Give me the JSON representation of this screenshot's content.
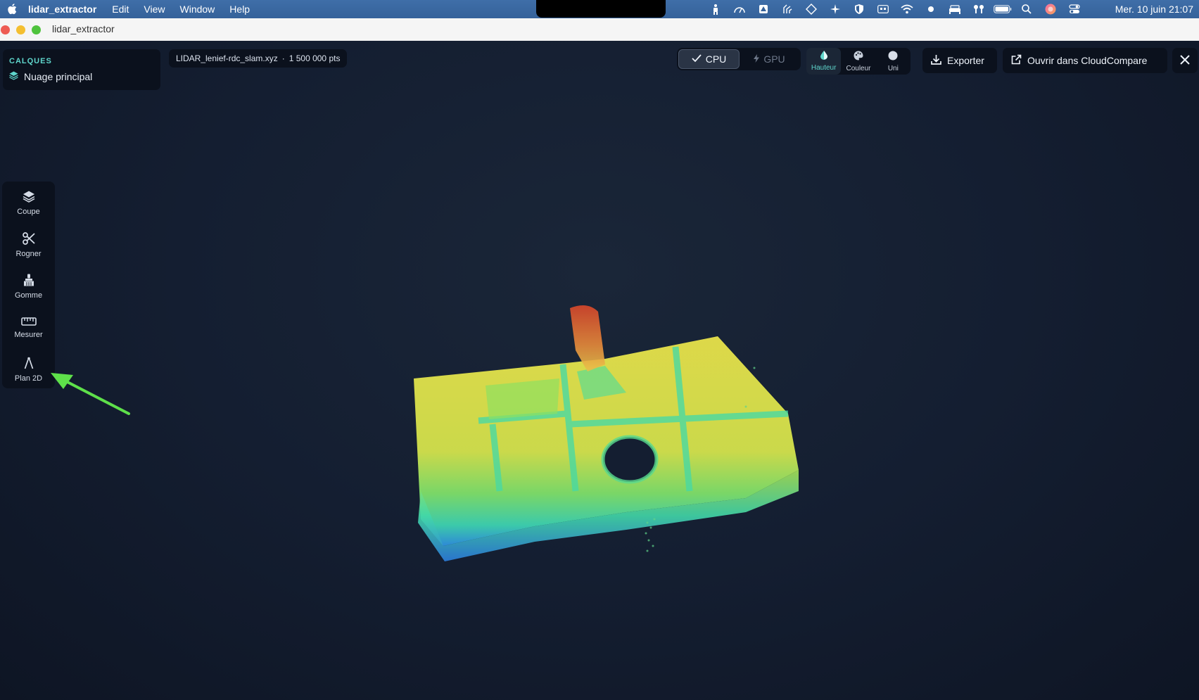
{
  "menubar": {
    "app_name": "lidar_extractor",
    "items": [
      "Edit",
      "View",
      "Window",
      "Help"
    ],
    "status_icons": [
      "accessibility-icon",
      "speed-icon",
      "drive-icon",
      "hands-icon",
      "diamond-icon",
      "sparkle-icon",
      "shield-icon",
      "keyboard-icon",
      "wifi-icon",
      "dot-icon",
      "bed-icon",
      "airpods-icon",
      "battery-icon",
      "search-icon",
      "siri-icon",
      "control-center-icon"
    ],
    "clock": "Mer. 10 juin  21:07"
  },
  "window": {
    "title": "lidar_extractor"
  },
  "layers": {
    "header": "CALQUES",
    "item": "Nuage principal"
  },
  "file": {
    "name": "LIDAR_lenief-rdc_slam.xyz",
    "separator": "·",
    "points": "1 500 000 pts"
  },
  "compute": {
    "cpu": "CPU",
    "gpu": "GPU",
    "selected": "CPU"
  },
  "color_modes": {
    "selected": "Hauteur",
    "items": [
      {
        "label": "Hauteur",
        "icon": "drop-icon"
      },
      {
        "label": "Couleur",
        "icon": "palette-icon"
      },
      {
        "label": "Uni",
        "icon": "circle-icon"
      }
    ]
  },
  "actions": {
    "export": "Exporter",
    "open_cc": "Ouvrir dans CloudCompare"
  },
  "tools": [
    {
      "label": "Coupe",
      "icon": "layers-icon"
    },
    {
      "label": "Rogner",
      "icon": "scissors-icon"
    },
    {
      "label": "Gomme",
      "icon": "brush-icon"
    },
    {
      "label": "Mesurer",
      "icon": "ruler-icon"
    },
    {
      "label": "Plan 2D",
      "icon": "compass-icon"
    }
  ],
  "colors": {
    "accent": "#5fd6cc",
    "arrow": "#5ee04a",
    "panel": "#0b111d"
  }
}
